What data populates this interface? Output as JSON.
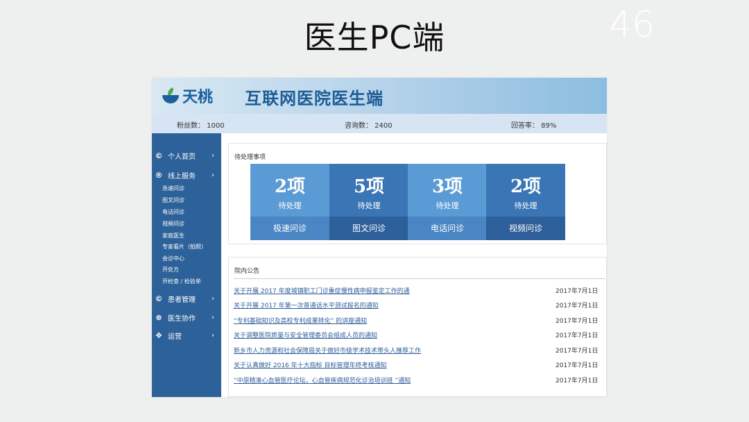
{
  "slide": {
    "title": "医生PC端",
    "page_number": "46"
  },
  "header": {
    "logo_text": "天桃",
    "title": "互联网医院医生端"
  },
  "stats": {
    "followers": "粉丝数： 1000",
    "consultations": "咨询数： 2400",
    "answer_rate": "回答率： 89%"
  },
  "sidebar": {
    "items": [
      {
        "icon": "©",
        "label": "个人首页"
      },
      {
        "icon": "®",
        "label": "线上服务"
      },
      {
        "icon": "©",
        "label": "患者管理"
      },
      {
        "icon": "⊗",
        "label": "医生协作"
      },
      {
        "icon": "✥",
        "label": "运营"
      }
    ],
    "sub_items": [
      "急速问诊",
      "图文问诊",
      "电话问诊",
      "视频问诊",
      "家庭医生",
      "专家看片（拍照）",
      "会诊中心",
      "开处方",
      "开检查 / 检验单"
    ],
    "arrow": "›"
  },
  "pending": {
    "title": "待处理事项",
    "tiles": [
      {
        "count": "2项",
        "status": "待处理",
        "label": "极速问诊"
      },
      {
        "count": "5项",
        "status": "待处理",
        "label": "图文问诊"
      },
      {
        "count": "3项",
        "status": "待处理",
        "label": "电话问诊"
      },
      {
        "count": "2项",
        "status": "待处理",
        "label": "视频问诊"
      }
    ]
  },
  "notices": {
    "title": "院内公告",
    "items": [
      {
        "text": "关于开展 2017 年度城镇职工门诊重症慢性病申报鉴定工作的通",
        "date": "2017年7月1日"
      },
      {
        "text": "关于开展 2017 年第一次普通话水平测试报名的通知",
        "date": "2017年7月1日"
      },
      {
        "text": "“专利基础知识及高校专利成果转化” 的讲座通知",
        "date": "2017年7月1日"
      },
      {
        "text": "关于调整医院质量与安全管理委员会组成人员的通知",
        "date": "2017年7月1日"
      },
      {
        "text": "新乡市人力资源和社会保障局关于做好市级学术技术带头人推荐工作",
        "date": "2017年7月1日"
      },
      {
        "text": "关于认真做好 2016 年十大指标 目标管理年终考核通知",
        "date": "2017年7月1日"
      },
      {
        "text": "“中原精准心血管医疗论坛，心血管疾病规范化诊治培训班 ”通知",
        "date": "2017年7月1日"
      }
    ]
  },
  "colors": {
    "sidebar": "#2c6199",
    "tile_light_top": "#5b9bd5",
    "tile_light_bottom": "#4a86c3",
    "tile_dark_top": "#3a75b5",
    "tile_dark_bottom": "#2d5f9a"
  }
}
